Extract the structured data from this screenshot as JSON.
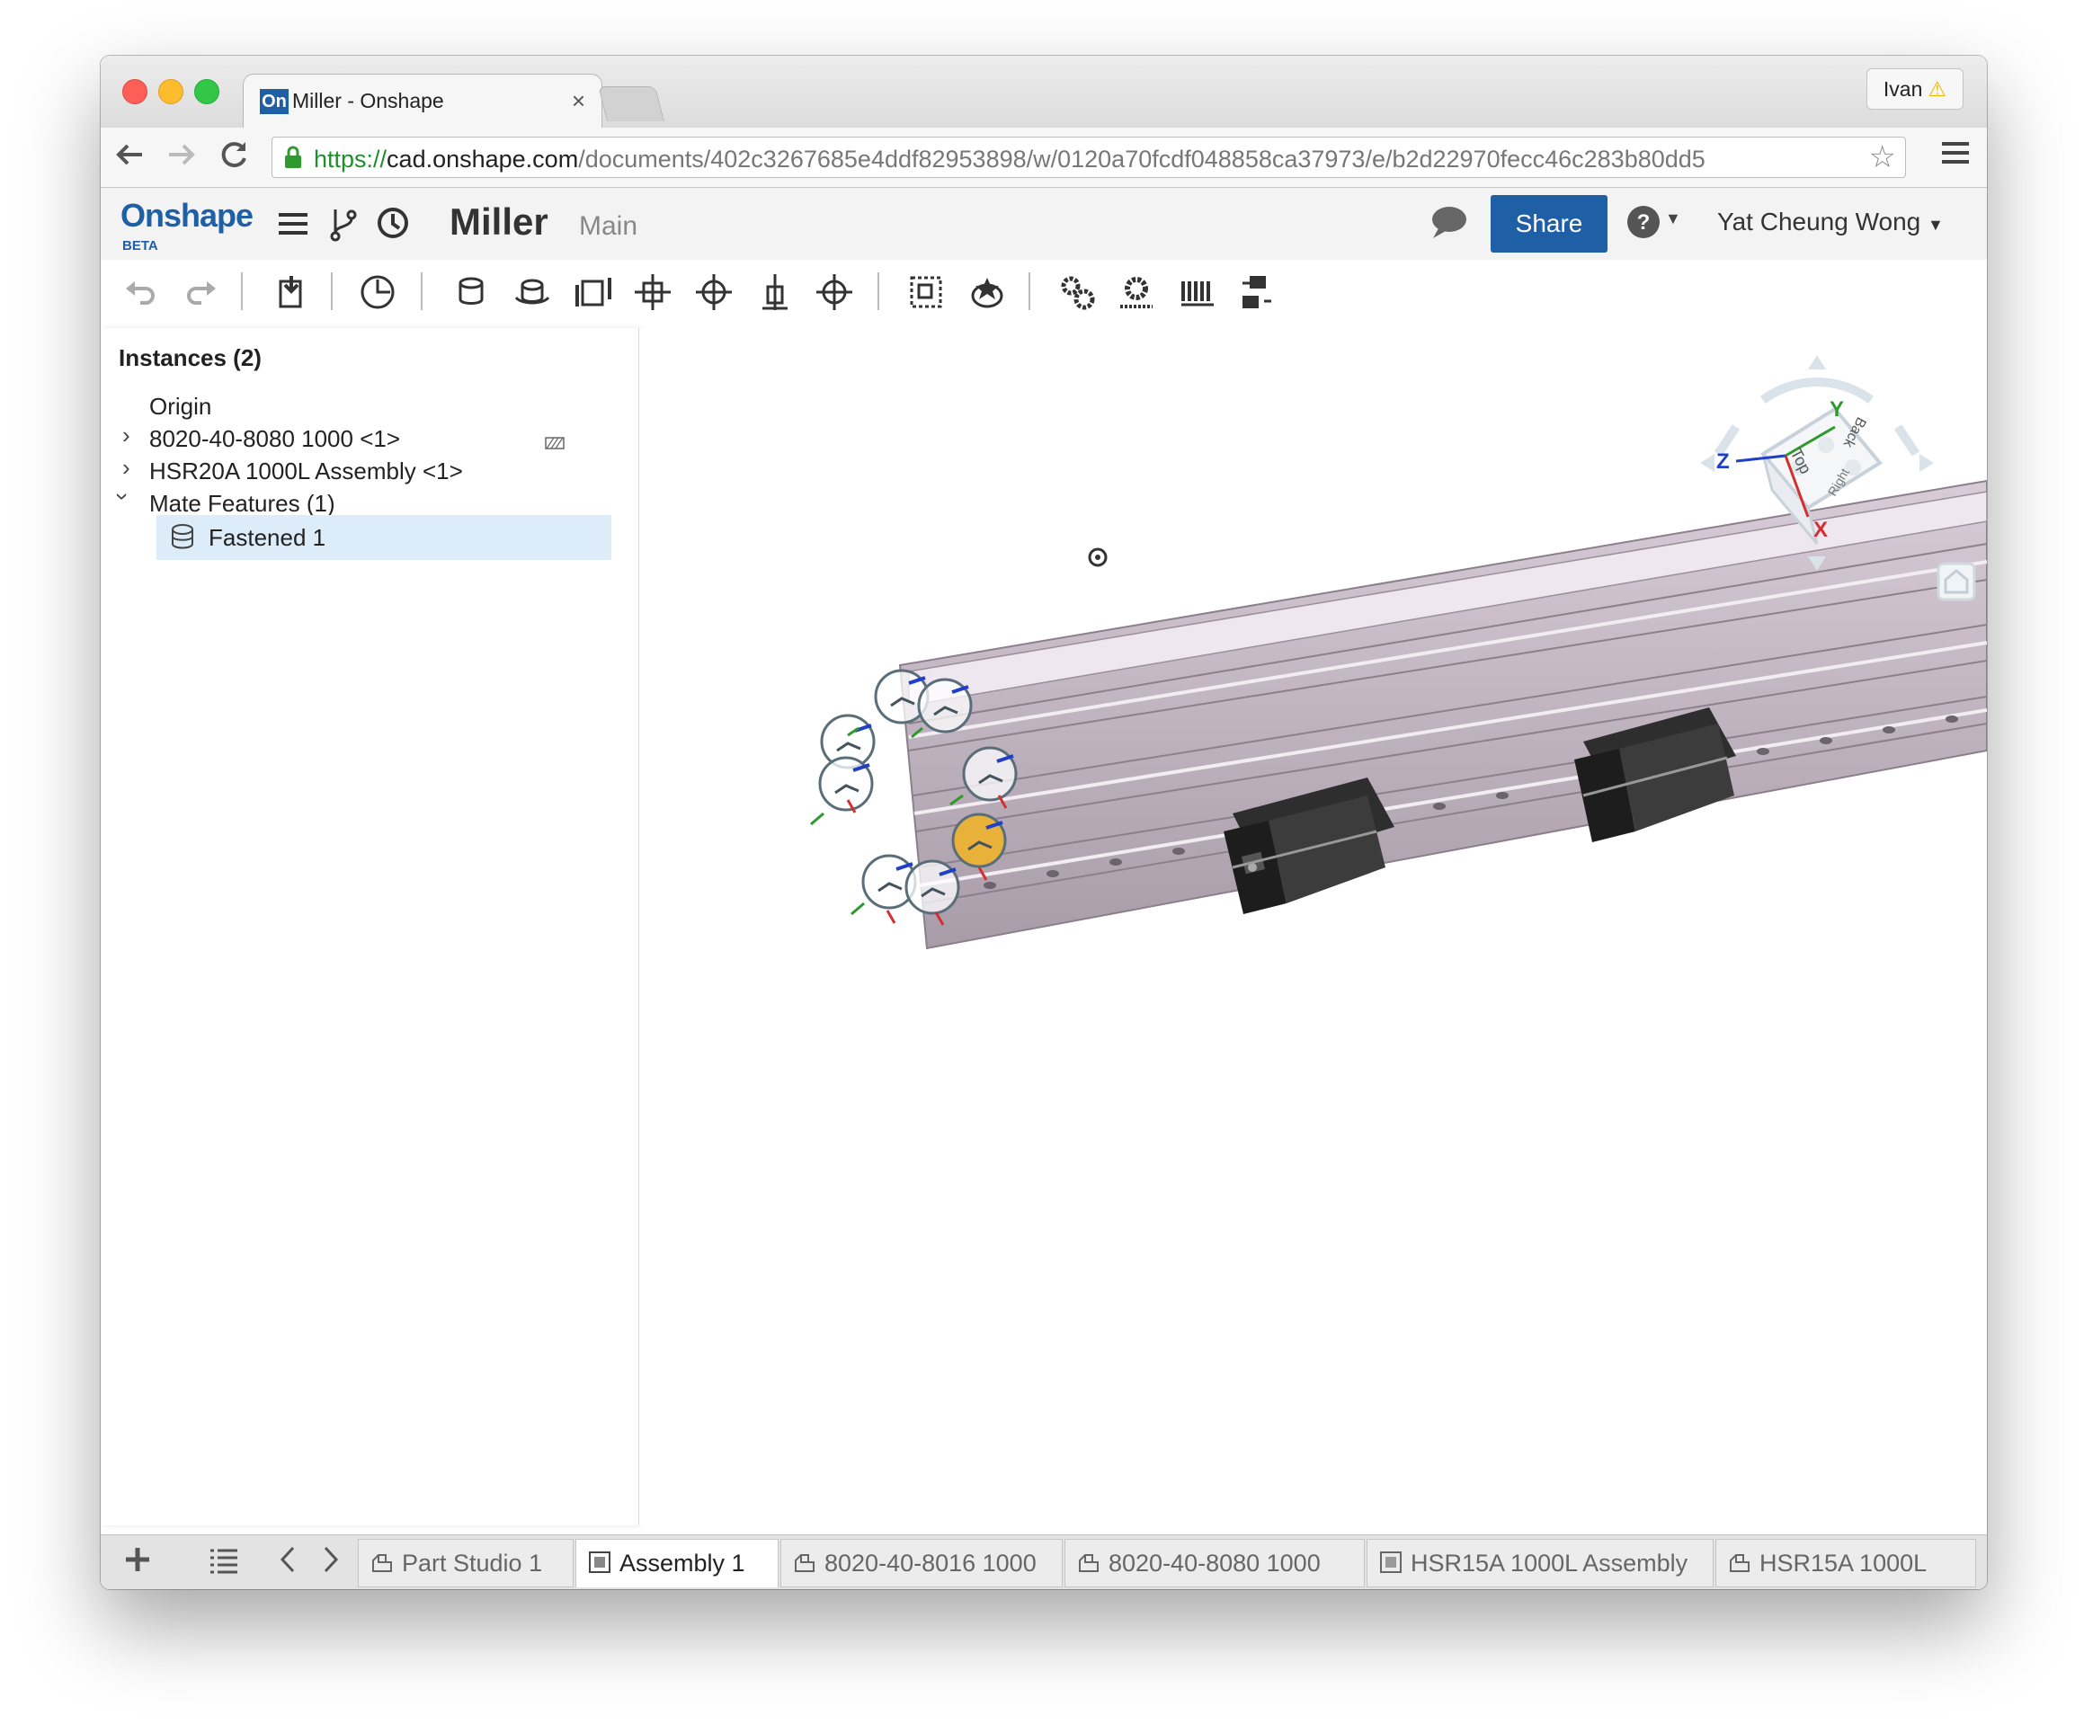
{
  "browser": {
    "tab_title": "Miller - Onshape",
    "tab_favicon_text": "On",
    "tab_close": "×",
    "profile_name": "Ivan",
    "profile_warning": "⚠",
    "url_protocol": "https://",
    "url_host": "cad.onshape.com",
    "url_path": "/documents/402c3267685e4ddf82953898/w/0120a70fcdf048858ca37973/e/b2d22970fecc46c283b80dd5"
  },
  "header": {
    "logo": "Onshape",
    "logo_badge": "BETA",
    "document_name": "Miller",
    "workspace": "Main",
    "share_label": "Share",
    "user_name": "Yat Cheung Wong"
  },
  "instances_panel": {
    "title": "Instances (2)",
    "items": [
      {
        "label": "Origin",
        "expandable": false
      },
      {
        "label": "8020-40-8080 1000 <1>",
        "expandable": true
      },
      {
        "label": "HSR20A 1000L Assembly <1>",
        "expandable": true
      },
      {
        "label": "Mate Features (1)",
        "expandable": true,
        "expanded": true
      },
      {
        "label": "Fastened 1",
        "selected": true
      }
    ]
  },
  "view_cube": {
    "axis_x": "X",
    "axis_y": "Y",
    "axis_z": "Z",
    "face_top": "Top",
    "face_back": "Back",
    "face_right": "Right"
  },
  "tabs": [
    {
      "label": "Part Studio 1",
      "type": "part-studio",
      "active": false
    },
    {
      "label": "Assembly 1",
      "type": "assembly",
      "active": true
    },
    {
      "label": "8020-40-8016 1000",
      "type": "part-studio",
      "active": false
    },
    {
      "label": "8020-40-8080 1000",
      "type": "part-studio",
      "active": false
    },
    {
      "label": "HSR15A 1000L Assembly",
      "type": "assembly",
      "active": false
    },
    {
      "label": "HSR15A 1000L",
      "type": "part-studio",
      "active": false
    }
  ],
  "colors": {
    "brand": "#1f5fa6",
    "selection": "#dcecf8",
    "extrusion": "#d9cdd8",
    "axis_x": "#d32f2f",
    "axis_y": "#2e9a2e",
    "axis_z": "#1f3fc8",
    "mate_highlight": "#e8b23a"
  }
}
